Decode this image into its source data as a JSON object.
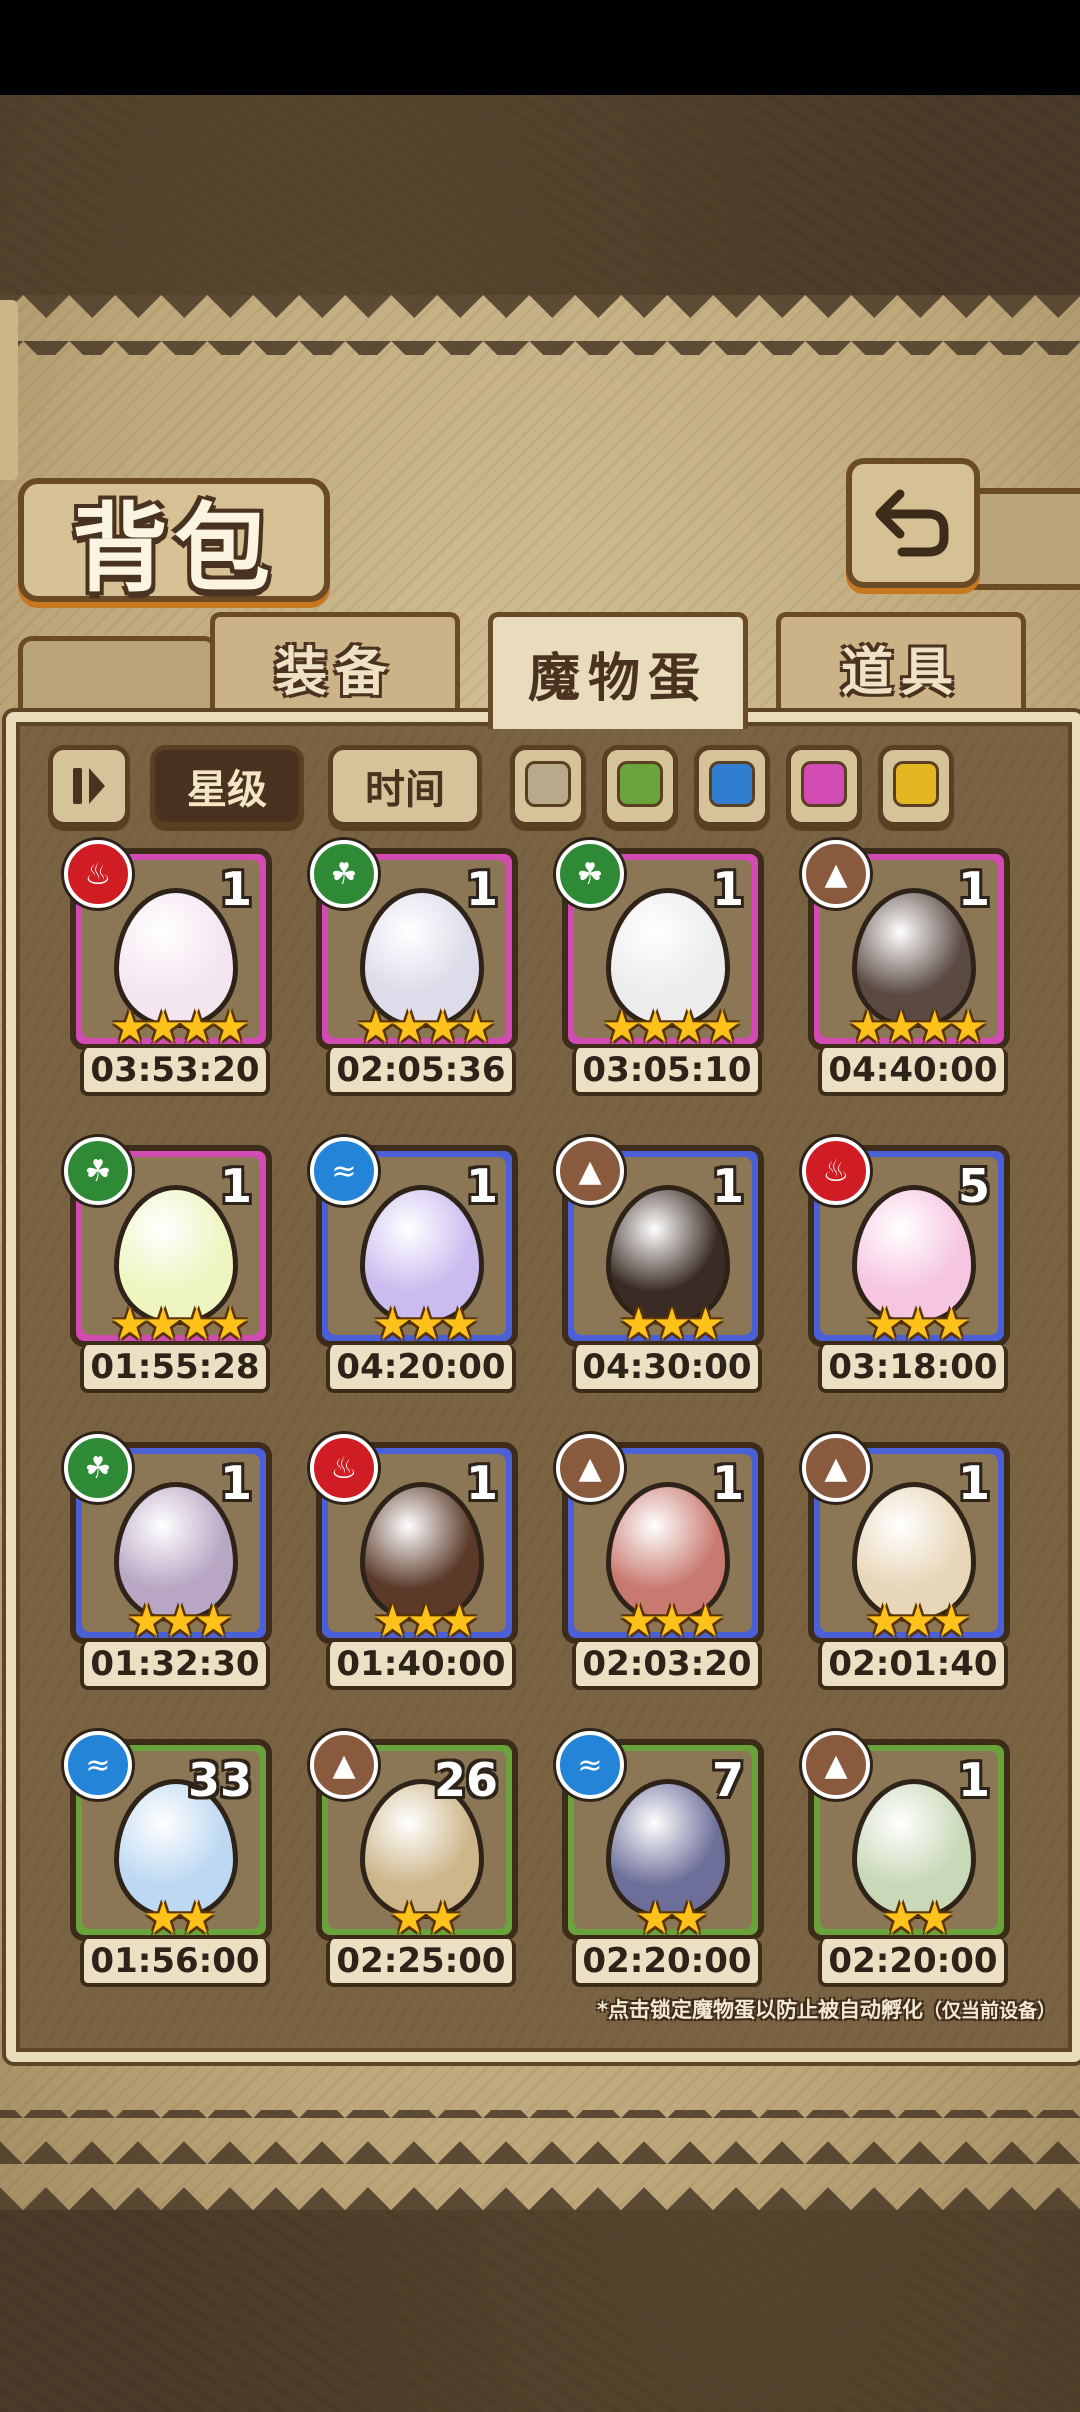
{
  "header": {
    "title": "背包"
  },
  "tabs": [
    {
      "label": "装备",
      "active": false
    },
    {
      "label": "魔物蛋",
      "active": true
    },
    {
      "label": "道具",
      "active": false
    }
  ],
  "filters": {
    "sort_star": "星级",
    "sort_time": "时间",
    "color_swatches": [
      "#b7a98a",
      "#6aa23c",
      "#2f7ed0",
      "#d24bb3",
      "#e3b520"
    ]
  },
  "eggs": [
    {
      "element": "fire",
      "count": "1",
      "stars": "★★★★",
      "timer": "03:53:20",
      "frame": "pink",
      "egg_color": "#f4e6f1"
    },
    {
      "element": "leaf",
      "count": "1",
      "stars": "★★★★",
      "timer": "02:05:36",
      "frame": "pink",
      "egg_color": "#dedbea"
    },
    {
      "element": "leaf",
      "count": "1",
      "stars": "★★★★",
      "timer": "03:05:10",
      "frame": "pink",
      "egg_color": "#ececec"
    },
    {
      "element": "earth",
      "count": "1",
      "stars": "★★★★",
      "timer": "04:40:00",
      "frame": "pink",
      "egg_color": "#5a4a42"
    },
    {
      "element": "leaf",
      "count": "1",
      "stars": "★★★★",
      "timer": "01:55:28",
      "frame": "pink",
      "egg_color": "#eef5c0"
    },
    {
      "element": "water",
      "count": "1",
      "stars": "★★★",
      "timer": "04:20:00",
      "frame": "blue",
      "egg_color": "#cbbcf0"
    },
    {
      "element": "earth",
      "count": "1",
      "stars": "★★★",
      "timer": "04:30:00",
      "frame": "blue",
      "egg_color": "#3a2c24"
    },
    {
      "element": "fire",
      "count": "5",
      "stars": "★★★",
      "timer": "03:18:00",
      "frame": "blue",
      "egg_color": "#f6c6e0"
    },
    {
      "element": "leaf",
      "count": "1",
      "stars": "★★★",
      "timer": "01:32:30",
      "frame": "blue",
      "egg_color": "#b8a6c4"
    },
    {
      "element": "fire",
      "count": "1",
      "stars": "★★★",
      "timer": "01:40:00",
      "frame": "blue",
      "egg_color": "#5b3a2a"
    },
    {
      "element": "earth",
      "count": "1",
      "stars": "★★★",
      "timer": "02:03:20",
      "frame": "blue",
      "egg_color": "#c97a70"
    },
    {
      "element": "earth",
      "count": "1",
      "stars": "★★★",
      "timer": "02:01:40",
      "frame": "blue",
      "egg_color": "#e8d6b8"
    },
    {
      "element": "water",
      "count": "33",
      "stars": "★★",
      "timer": "01:56:00",
      "frame": "green",
      "egg_color": "#bcd8f2"
    },
    {
      "element": "earth",
      "count": "26",
      "stars": "★★",
      "timer": "02:25:00",
      "frame": "green",
      "egg_color": "#cdb68a"
    },
    {
      "element": "water",
      "count": "7",
      "stars": "★★",
      "timer": "02:20:00",
      "frame": "green",
      "egg_color": "#6d6f9a"
    },
    {
      "element": "earth",
      "count": "1",
      "stars": "★★",
      "timer": "02:20:00",
      "frame": "green",
      "egg_color": "#c9d8b8"
    }
  ],
  "footnote": {
    "main": "*点击锁定魔物蛋以防止被自动孵化",
    "suffix": "（仅当前设备）"
  }
}
